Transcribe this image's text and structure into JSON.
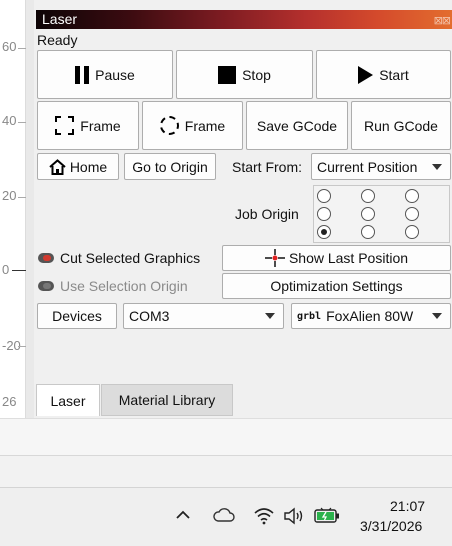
{
  "ruler": {
    "ticks": [
      "60",
      "40",
      "20",
      "0",
      "-20",
      "26"
    ]
  },
  "panel": {
    "title": "Laser",
    "title_controls": "⊠⊠",
    "status": "Ready"
  },
  "buttons": {
    "pause": "Pause",
    "stop": "Stop",
    "start": "Start",
    "frame_rect": "Frame",
    "frame_circle": "Frame",
    "save_gcode": "Save GCode",
    "run_gcode": "Run GCode",
    "home": "Home",
    "go_to_origin": "Go to Origin",
    "show_last_position": "Show Last Position",
    "optimization_settings": "Optimization Settings",
    "devices": "Devices"
  },
  "start_from": {
    "label": "Start From:",
    "value": "Current Position"
  },
  "job_origin": {
    "label": "Job Origin",
    "selected": "bottom-left"
  },
  "toggles": {
    "cut_selected": {
      "label": "Cut Selected Graphics",
      "on": true
    },
    "use_selection_origin": {
      "label": "Use Selection Origin",
      "on": false
    }
  },
  "port": {
    "value": "COM3"
  },
  "profile": {
    "prefix": "grbl",
    "value": "FoxAlien 80W"
  },
  "tabs": [
    {
      "label": "Laser",
      "active": true
    },
    {
      "label": "Material Library",
      "active": false
    }
  ],
  "taskbar": {
    "time": "21:07",
    "date": "3/31/2026",
    "icons": [
      "chevron-up-icon",
      "cloud-icon",
      "wifi-icon",
      "speaker-icon",
      "battery-icon"
    ]
  }
}
